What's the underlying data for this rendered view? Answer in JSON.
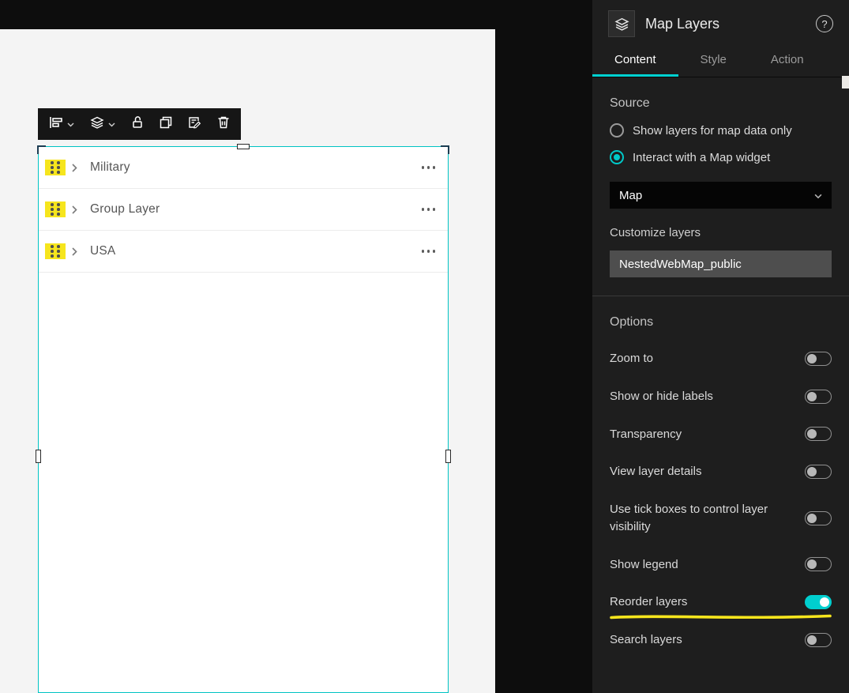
{
  "colors": {
    "accent_teal": "#00cfcf",
    "annotation_yellow": "#f6e51d",
    "panel_background": "#1e1e1e",
    "selection_outline": "#00c3c3"
  },
  "panel": {
    "title": "Map Layers",
    "help_label": "?",
    "tabs": [
      {
        "label": "Content",
        "active": true
      },
      {
        "label": "Style",
        "active": false
      },
      {
        "label": "Action",
        "active": false
      }
    ],
    "source": {
      "heading": "Source",
      "radios": [
        {
          "label": "Show layers for map data only",
          "selected": false
        },
        {
          "label": "Interact with a Map widget",
          "selected": true
        }
      ],
      "map_select_value": "Map",
      "customize_label": "Customize layers",
      "selected_map": "NestedWebMap_public"
    },
    "options": {
      "heading": "Options",
      "toggles": [
        {
          "label": "Zoom to",
          "on": false
        },
        {
          "label": "Show or hide labels",
          "on": false
        },
        {
          "label": "Transparency",
          "on": false
        },
        {
          "label": "View layer details",
          "on": false
        },
        {
          "label": "Use tick boxes to control layer visibility",
          "on": false
        },
        {
          "label": "Show legend",
          "on": false
        },
        {
          "label": "Reorder layers",
          "on": true,
          "annotated": true
        },
        {
          "label": "Search layers",
          "on": false
        }
      ]
    }
  },
  "canvas": {
    "toolbar_icons": [
      "align-left-dropdown",
      "layers-dropdown",
      "unlock",
      "duplicate",
      "edit-list",
      "delete"
    ],
    "layer_list": [
      {
        "label": "Military"
      },
      {
        "label": "Group Layer"
      },
      {
        "label": "USA"
      }
    ]
  }
}
